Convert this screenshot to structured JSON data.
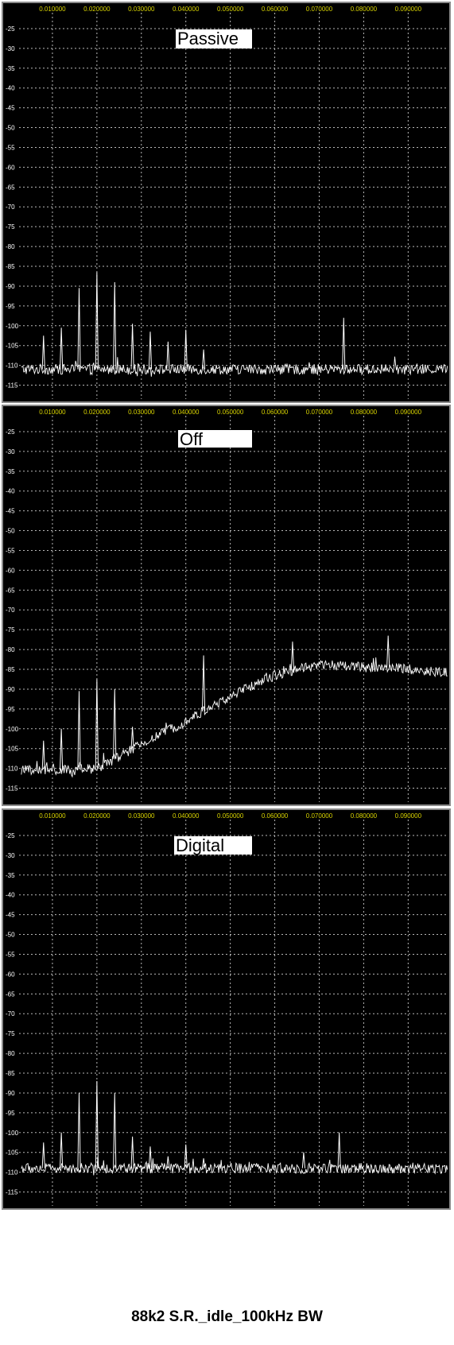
{
  "caption": "88k2 S.R._idle_100kHz BW",
  "colors": {
    "background": "#000000",
    "grid": "#b8b8b8",
    "trace": "#ffffff",
    "x_tick_text": "#d9d400",
    "y_tick_text": "#ffffff",
    "label_box": "#ffffff"
  },
  "chart_data": [
    {
      "type": "line",
      "title": "Passive",
      "x_tick_labels": [
        "0.010000",
        "0.020000",
        "0.030000",
        "0.040000",
        "0.050000",
        "0.060000",
        "0.070000",
        "0.080000",
        "0.090000"
      ],
      "y_tick_labels": [
        "-25",
        "-30",
        "-35",
        "-40",
        "-45",
        "-50",
        "-55",
        "-60",
        "-65",
        "-70",
        "-75",
        "-80",
        "-85",
        "-90",
        "-95",
        "-100",
        "-105",
        "-110",
        "-115"
      ],
      "xlim": [
        0.0025,
        0.0987
      ],
      "ylim": [
        -118.5,
        -21
      ],
      "grid": true,
      "floor": [
        [
          0.003,
          -111
        ],
        [
          0.099,
          -111
        ]
      ],
      "peaks": [
        [
          0.008,
          -102.5
        ],
        [
          0.012,
          -100.5
        ],
        [
          0.016,
          -90.5
        ],
        [
          0.02,
          -86.5
        ],
        [
          0.024,
          -89
        ],
        [
          0.028,
          -99.5
        ],
        [
          0.032,
          -101.5
        ],
        [
          0.036,
          -104
        ],
        [
          0.04,
          -101
        ],
        [
          0.044,
          -106
        ],
        [
          0.0755,
          -98
        ]
      ]
    },
    {
      "type": "line",
      "title": "Off",
      "x_tick_labels": [
        "0.010000",
        "0.020000",
        "0.030000",
        "0.040000",
        "0.050000",
        "0.060000",
        "0.070000",
        "0.080000",
        "0.090000"
      ],
      "y_tick_labels": [
        "-25",
        "-30",
        "-35",
        "-40",
        "-45",
        "-50",
        "-55",
        "-60",
        "-65",
        "-70",
        "-75",
        "-80",
        "-85",
        "-90",
        "-95",
        "-100",
        "-105",
        "-110",
        "-115"
      ],
      "xlim": [
        0.0025,
        0.0987
      ],
      "ylim": [
        -118.5,
        -21
      ],
      "grid": true,
      "floor": [
        [
          0.003,
          -110.5
        ],
        [
          0.015,
          -110.5
        ],
        [
          0.02,
          -110
        ],
        [
          0.025,
          -107
        ],
        [
          0.03,
          -104
        ],
        [
          0.035,
          -101
        ],
        [
          0.04,
          -98
        ],
        [
          0.045,
          -95
        ],
        [
          0.05,
          -92
        ],
        [
          0.055,
          -89
        ],
        [
          0.06,
          -86.5
        ],
        [
          0.065,
          -85
        ],
        [
          0.07,
          -84
        ],
        [
          0.075,
          -84
        ],
        [
          0.08,
          -84.5
        ],
        [
          0.085,
          -84.5
        ],
        [
          0.09,
          -85
        ],
        [
          0.095,
          -85.5
        ],
        [
          0.099,
          -86
        ]
      ],
      "peaks": [
        [
          0.008,
          -103
        ],
        [
          0.012,
          -100
        ],
        [
          0.016,
          -90.5
        ],
        [
          0.02,
          -87.5
        ],
        [
          0.024,
          -90
        ],
        [
          0.028,
          -99.5
        ],
        [
          0.044,
          -81.5
        ],
        [
          0.064,
          -78
        ],
        [
          0.0855,
          -76.5
        ]
      ]
    },
    {
      "type": "line",
      "title": "Digital",
      "x_tick_labels": [
        "0.010000",
        "0.020000",
        "0.030000",
        "0.040000",
        "0.050000",
        "0.060000",
        "0.070000",
        "0.080000",
        "0.090000"
      ],
      "y_tick_labels": [
        "-25",
        "-30",
        "-35",
        "-40",
        "-45",
        "-50",
        "-55",
        "-60",
        "-65",
        "-70",
        "-75",
        "-80",
        "-85",
        "-90",
        "-95",
        "-100",
        "-105",
        "-110",
        "-115"
      ],
      "xlim": [
        0.0025,
        0.0987
      ],
      "ylim": [
        -118.5,
        -21
      ],
      "grid": true,
      "floor": [
        [
          0.003,
          -109
        ],
        [
          0.099,
          -109
        ]
      ],
      "peaks": [
        [
          0.008,
          -102.5
        ],
        [
          0.012,
          -100
        ],
        [
          0.016,
          -90
        ],
        [
          0.02,
          -87
        ],
        [
          0.024,
          -90
        ],
        [
          0.028,
          -101
        ],
        [
          0.032,
          -103.5
        ],
        [
          0.036,
          -106
        ],
        [
          0.04,
          -103
        ],
        [
          0.044,
          -106.5
        ],
        [
          0.0665,
          -105
        ],
        [
          0.0745,
          -100
        ]
      ]
    }
  ]
}
